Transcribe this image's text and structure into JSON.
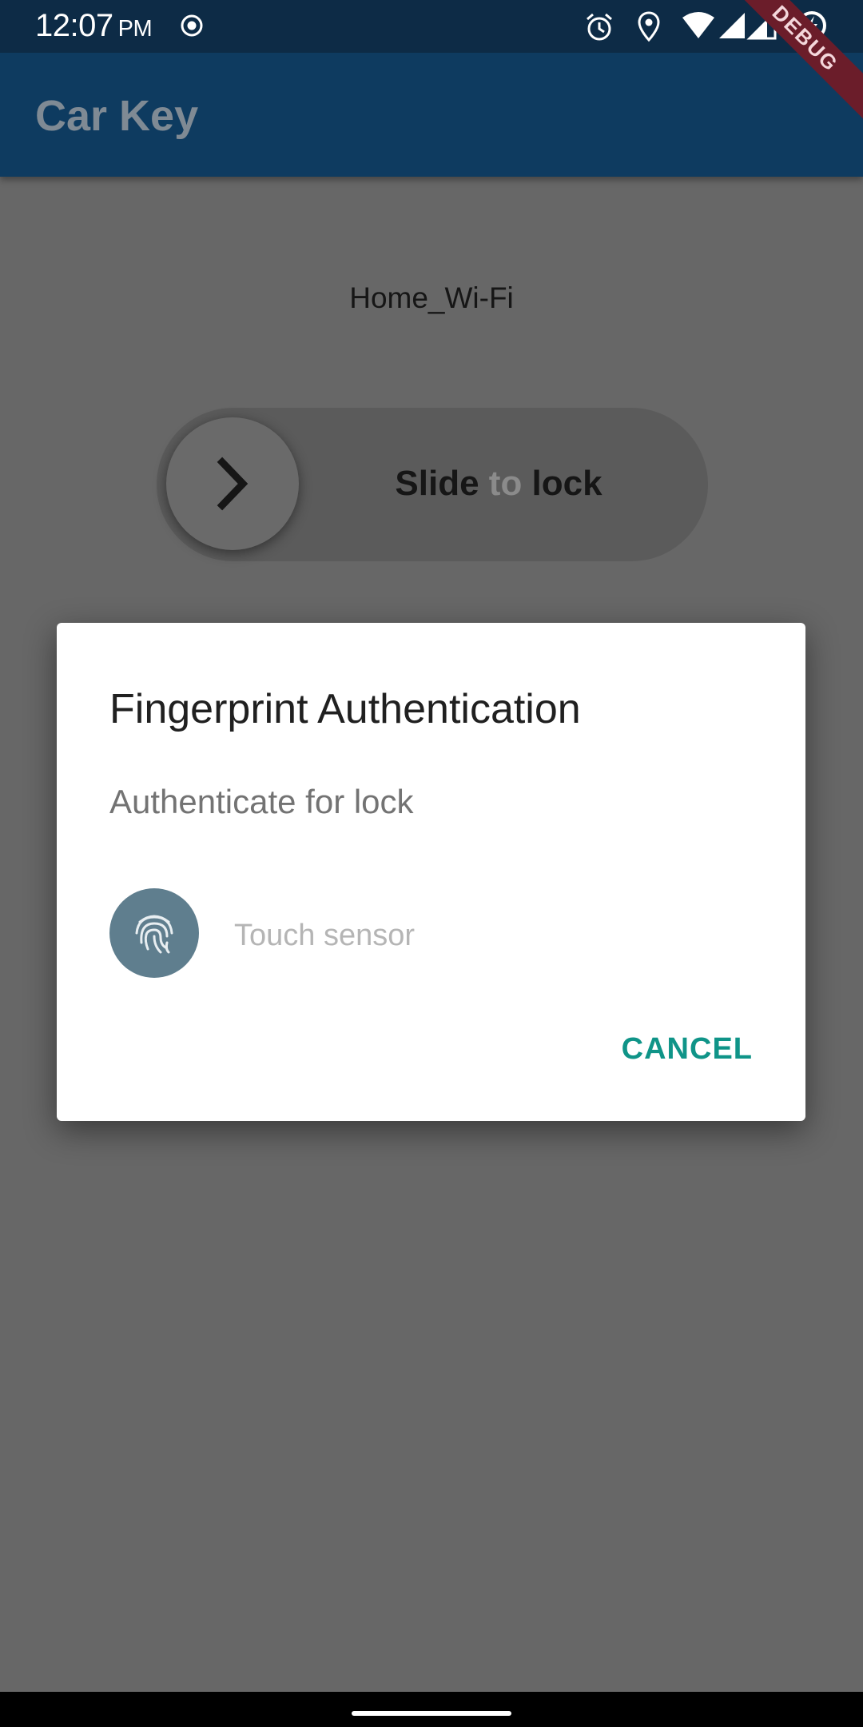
{
  "status_bar": {
    "time": "12:07",
    "ampm": "PM"
  },
  "app_bar": {
    "title": "Car Key",
    "debug_label": "DEBUG"
  },
  "main": {
    "network_name": "Home_Wi-Fi",
    "slider": {
      "label_part1": "Slide",
      "label_part2": " to ",
      "label_part3": "lock"
    }
  },
  "dialog": {
    "title": "Fingerprint Authentication",
    "description": "Authenticate for lock",
    "sensor_hint": "Touch sensor",
    "cancel_label": "CANCEL"
  },
  "colors": {
    "status_bar": "#0d2b46",
    "app_bar": "#0e3b60",
    "scrim_background": "#676767",
    "fingerprint_circle": "#5f7e8e",
    "cancel_accent": "#0f9488"
  },
  "icons": [
    "record-icon",
    "alarm-icon",
    "location-icon",
    "wifi-icon",
    "signal-icon",
    "battery-charging-icon",
    "chevron-right-icon",
    "fingerprint-icon"
  ]
}
